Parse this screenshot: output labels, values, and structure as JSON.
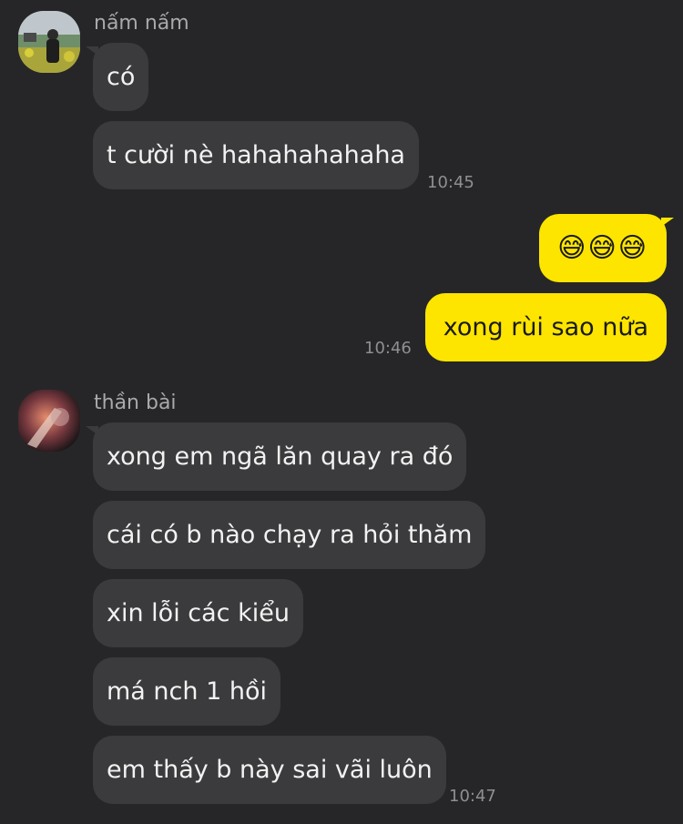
{
  "conversation": {
    "group1": {
      "sender": "nấm nấm",
      "messages": [
        "có",
        "t cười nè hahahahahaha"
      ],
      "time": "10:45"
    },
    "mine": {
      "messages": [
        "😅😅😅",
        "xong rùi sao nữa"
      ],
      "time": "10:46"
    },
    "group2": {
      "sender": "thần bài",
      "messages": [
        "xong em ngã lăn quay ra đó",
        "cái có b nào chạy ra hỏi thăm",
        "xin lỗi các kiểu",
        "má nch 1 hồi",
        "em thấy b này sai vãi luôn"
      ],
      "time": "10:47"
    }
  },
  "colors": {
    "background": "#262628",
    "incoming_bubble": "#3b3b3d",
    "outgoing_bubble": "#fde500"
  }
}
